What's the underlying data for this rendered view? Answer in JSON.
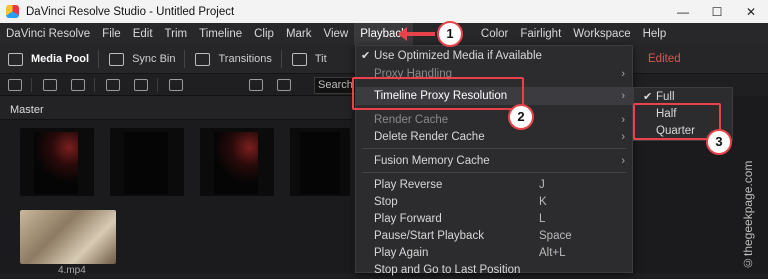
{
  "window": {
    "title": "DaVinci Resolve Studio - Untitled Project",
    "controls": [
      "—",
      "☐",
      "✕"
    ]
  },
  "menubar": {
    "items": [
      "DaVinci Resolve",
      "File",
      "Edit",
      "Trim",
      "Timeline",
      "Clip",
      "Mark",
      "View",
      "Playback",
      "Color",
      "Fairlight",
      "Workspace",
      "Help"
    ]
  },
  "toolbar": {
    "media_pool": "Media Pool",
    "sync_bin": "Sync Bin",
    "transitions": "Transitions",
    "titles_partial": "Tit",
    "edited": "Edited"
  },
  "search": {
    "placeholder": "Search"
  },
  "media_pool": {
    "bin_label": "Master",
    "file_label_partial": "4.mp4"
  },
  "playback_menu": {
    "items": [
      {
        "label": "Use Optimized Media if Available",
        "checked": true,
        "disabled": false
      },
      {
        "label": "Proxy Handling",
        "submenu": true,
        "disabled": true
      },
      {
        "label": "Timeline Proxy Resolution",
        "submenu": true,
        "highlighted": true
      },
      {
        "label": "Render Cache",
        "submenu": true,
        "disabled": true
      },
      {
        "label": "Delete Render Cache",
        "submenu": true,
        "disabled": false
      },
      {
        "label": "Fusion Memory Cache",
        "submenu": true,
        "disabled": false
      },
      {
        "label": "Play Reverse",
        "shortcut": "J"
      },
      {
        "label": "Stop",
        "shortcut": "K"
      },
      {
        "label": "Play Forward",
        "shortcut": "L"
      },
      {
        "label": "Pause/Start Playback",
        "shortcut": "Space"
      },
      {
        "label": "Play Again",
        "shortcut": "Alt+L"
      },
      {
        "label": "Stop and Go to Last Position",
        "shortcut": ""
      }
    ]
  },
  "proxy_resolution_submenu": {
    "items": [
      {
        "label": "Full",
        "checked": true
      },
      {
        "label": "Half",
        "checked": false
      },
      {
        "label": "Quarter",
        "checked": false
      }
    ]
  },
  "annotations": {
    "badges": [
      "1",
      "2",
      "3"
    ],
    "watermark": "©thegeekpage.com",
    "accent_color": "#e8434a"
  }
}
